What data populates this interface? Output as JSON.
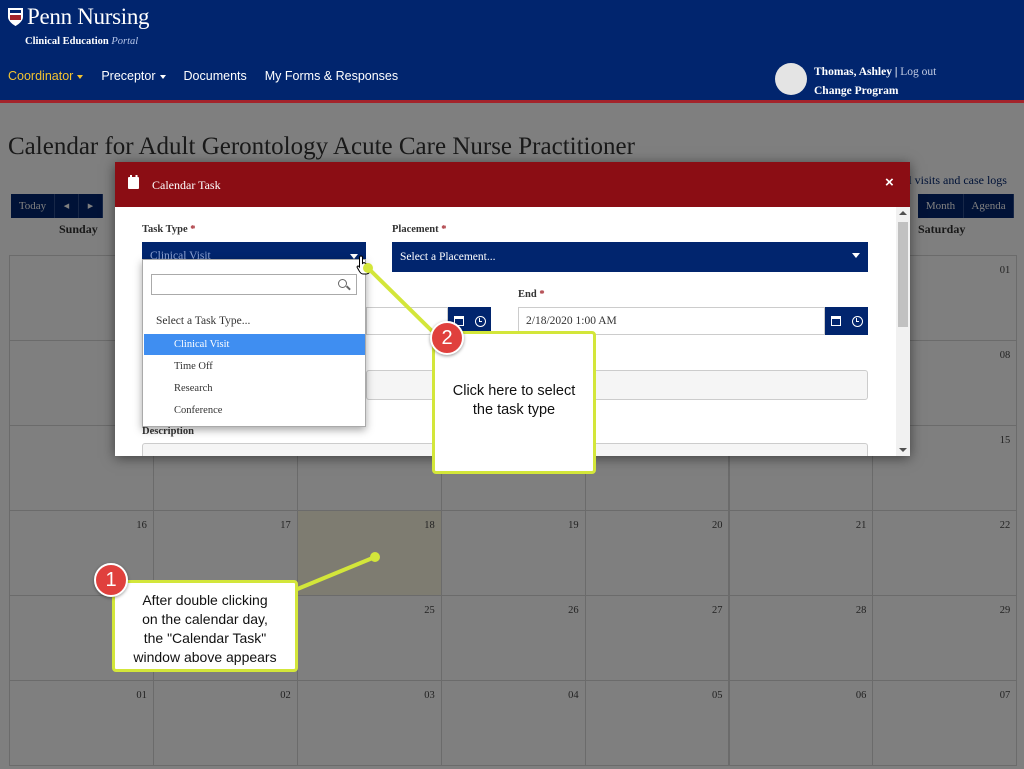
{
  "header": {
    "brand": "Penn Nursing",
    "subtitle": "Clinical Education",
    "subtitle_italic": "Portal",
    "nav": [
      {
        "label": "Coordinator",
        "caret": true,
        "active": true
      },
      {
        "label": "Preceptor",
        "caret": true,
        "active": false
      },
      {
        "label": "Documents",
        "caret": false,
        "active": false
      },
      {
        "label": "My Forms & Responses",
        "caret": false,
        "active": false
      }
    ],
    "user_name": "Thomas, Ashley |",
    "logout": "Log out",
    "change_program": "Change Program"
  },
  "page": {
    "title": "Calendar for Adult Gerontology Acute Care Nurse Practitioner",
    "today_btn": "Today",
    "prev_icon": "◀",
    "next_icon": "▶",
    "month_btn": "Month",
    "agenda_btn": "Agenda",
    "case_link": "al visits and case logs"
  },
  "calendar": {
    "day_headers": [
      "Sunday",
      "Saturday"
    ],
    "weeks": [
      [
        "",
        "",
        "",
        "",
        "",
        "",
        "01"
      ],
      [
        "",
        "",
        "",
        "",
        "",
        "",
        "08"
      ],
      [
        "",
        "",
        "",
        "",
        "",
        "",
        "15"
      ],
      [
        "16",
        "17",
        "18",
        "19",
        "20",
        "21",
        "22"
      ],
      [
        "",
        "",
        "25",
        "26",
        "27",
        "28",
        "29"
      ],
      [
        "01",
        "02",
        "03",
        "04",
        "05",
        "06",
        "07"
      ]
    ]
  },
  "modal": {
    "title": "Calendar Task",
    "close": "×",
    "task_type_label": "Task Type",
    "task_type_value": "Clinical Visit",
    "placement_label": "Placement",
    "placement_value": "Select a Placement...",
    "end_label": "End",
    "end_value": "2/18/2020 1:00 AM",
    "description_label": "Description",
    "required_mark": "*"
  },
  "dropdown": {
    "group": "Select a Task Type...",
    "options": [
      "Clinical Visit",
      "Time Off",
      "Research",
      "Conference"
    ],
    "selected": "Clinical Visit"
  },
  "callouts": {
    "one": {
      "number": "1",
      "text_lines": [
        "After double clicking",
        "on the calendar day,",
        "the \"Calendar Task\"",
        "window above appears"
      ]
    },
    "two": {
      "number": "2",
      "text_lines": [
        "Click here to select",
        "the task type"
      ]
    }
  },
  "colors": {
    "navy": "#01256e",
    "maroon": "#8b0d14",
    "highlight": "#d3e63a",
    "badge": "#e0403d"
  }
}
